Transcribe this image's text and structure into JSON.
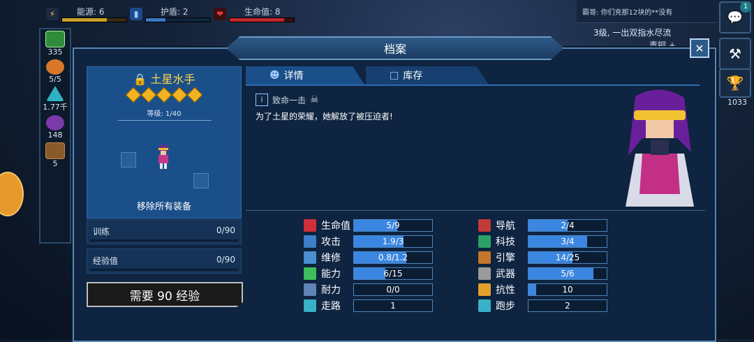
{
  "hud": {
    "energy_label": "能源: 6",
    "shield_label": "护盾: 2",
    "hp_label": "生命值: 8"
  },
  "resources": [
    "335",
    "5/5",
    "1.77千",
    "148",
    "5"
  ],
  "chat": {
    "message": "霸哥: 你们充那12块的**没有",
    "badge": "1",
    "line2": "3级, 一出双指水尽流",
    "line3": "青铜 +"
  },
  "right_buttons": {
    "trophy_count": "1033"
  },
  "panel": {
    "title": "档案"
  },
  "character": {
    "name": "土星水手",
    "level": "等级: 1/40",
    "remove_label": "移除所有装备",
    "training_label": "训练",
    "training_value": "0/90",
    "xp_label": "经验值",
    "xp_value": "0/90",
    "need_xp_label": "需要 90 经验"
  },
  "tabs": {
    "details": "详情",
    "inventory": "库存"
  },
  "skill": {
    "name": "致命一击",
    "description": "为了土星的荣耀，她解放了被压迫者!"
  },
  "stats_left": [
    {
      "label": "生命值",
      "value": "5/9",
      "fill": 0.555,
      "color": "#d0303a"
    },
    {
      "label": "攻击",
      "value": "1.9/3",
      "fill": 0.63,
      "color": "#3d7fc9"
    },
    {
      "label": "维修",
      "value": "0.8/1.2",
      "fill": 0.67,
      "color": "#4a8fcf"
    },
    {
      "label": "能力",
      "value": "6/15",
      "fill": 0.4,
      "color": "#3cbf5a"
    },
    {
      "label": "耐力",
      "value": "0/0",
      "fill": 0,
      "color": "#5f84b5"
    },
    {
      "label": "走路",
      "value": "1",
      "fill": 0,
      "color": "#37b1c8"
    }
  ],
  "stats_right": [
    {
      "label": "导航",
      "value": "2/4",
      "fill": 0.5,
      "color": "#c23a3a"
    },
    {
      "label": "科技",
      "value": "3/4",
      "fill": 0.75,
      "color": "#2da06a"
    },
    {
      "label": "引擎",
      "value": "14/25",
      "fill": 0.56,
      "color": "#c4762c"
    },
    {
      "label": "武器",
      "value": "5/6",
      "fill": 0.83,
      "color": "#9a9a9a"
    },
    {
      "label": "抗性",
      "value": "10",
      "fill": 0.1,
      "color": "#e3a02a"
    },
    {
      "label": "跑步",
      "value": "2",
      "fill": 0,
      "color": "#37b1c8"
    }
  ]
}
